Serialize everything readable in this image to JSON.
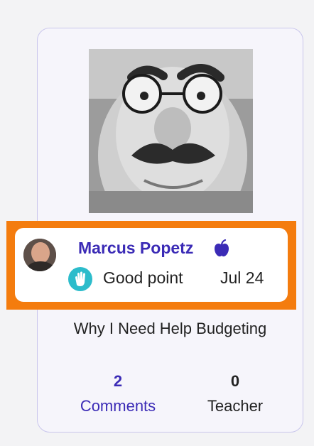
{
  "comment": {
    "author": "Marcus Popetz",
    "reaction": "Good point",
    "date": "Jul 24"
  },
  "post": {
    "title": "Why I Need Help Budgeting"
  },
  "stats": {
    "comments_count": "2",
    "comments_label": "Comments",
    "teacher_count": "0",
    "teacher_label": "Teacher"
  },
  "colors": {
    "accent": "#3b2bb6",
    "highlight": "#f47c0e",
    "reaction_badge": "#2cbccb",
    "card_border": "#c9c6ec"
  },
  "icons": {
    "author_badge": "apple-icon",
    "reaction": "waving-hand-icon"
  }
}
